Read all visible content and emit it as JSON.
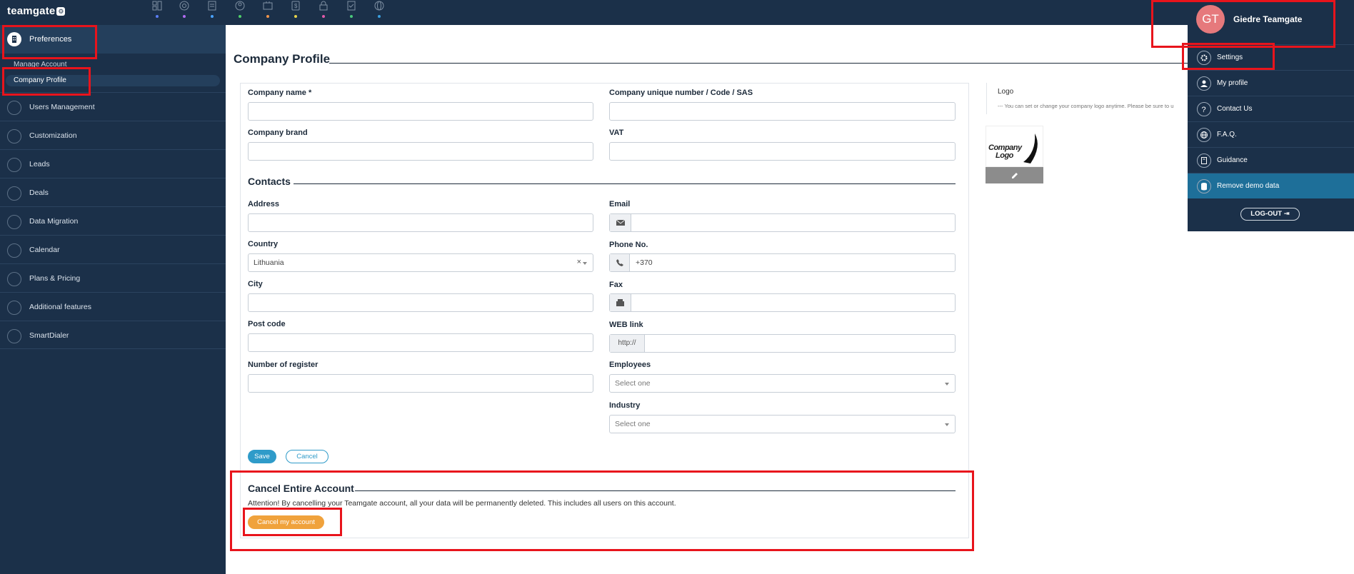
{
  "app": {
    "logo_text": "teamgate",
    "logo_badge": "⚙"
  },
  "topnav": {
    "icons": [
      {
        "name": "dashboard-icon",
        "dot": "#5b7ef5"
      },
      {
        "name": "target-icon",
        "dot": "#b06bf0"
      },
      {
        "name": "reports-icon",
        "dot": "#4aa3ff"
      },
      {
        "name": "leads-icon",
        "dot": "#4fd06a"
      },
      {
        "name": "deals-icon",
        "dot": "#f0934a"
      },
      {
        "name": "pipeline-icon",
        "dot": "#e8d34a"
      },
      {
        "name": "lock-icon",
        "dot": "#e05aa8"
      },
      {
        "name": "tasks-icon",
        "dot": "#49c77b"
      },
      {
        "name": "world-icon",
        "dot": "#3aa0e0"
      }
    ]
  },
  "sidebar": {
    "preferences": "Preferences",
    "sub_manage": "Manage Account",
    "sub_company": "Company Profile",
    "items": [
      {
        "label": "Users Management",
        "icon": "users-icon"
      },
      {
        "label": "Customization",
        "icon": "wrench-icon"
      },
      {
        "label": "Leads",
        "icon": "leads-icon"
      },
      {
        "label": "Deals",
        "icon": "deals-icon"
      },
      {
        "label": "Data Migration",
        "icon": "migration-icon"
      },
      {
        "label": "Calendar",
        "icon": "calendar-icon"
      },
      {
        "label": "Plans & Pricing",
        "icon": "pricing-icon"
      },
      {
        "label": "Additional features",
        "icon": "features-icon"
      },
      {
        "label": "SmartDialer",
        "icon": "phone-icon"
      }
    ]
  },
  "page": {
    "title": "Company Profile"
  },
  "form": {
    "company_name": {
      "label": "Company name *",
      "value": ""
    },
    "company_number": {
      "label": "Company unique number / Code / SAS",
      "value": ""
    },
    "company_brand": {
      "label": "Company brand",
      "value": ""
    },
    "vat": {
      "label": "VAT",
      "value": ""
    },
    "contacts_title": "Contacts",
    "address": {
      "label": "Address",
      "value": ""
    },
    "email": {
      "label": "Email",
      "value": ""
    },
    "country": {
      "label": "Country",
      "value": "Lithuania",
      "clear": "×"
    },
    "phone": {
      "label": "Phone No.",
      "value": "+370"
    },
    "city": {
      "label": "City",
      "value": ""
    },
    "fax": {
      "label": "Fax",
      "value": ""
    },
    "post_code": {
      "label": "Post code",
      "value": ""
    },
    "web": {
      "label": "WEB link",
      "prefix": "http://",
      "value": ""
    },
    "register": {
      "label": "Number of register",
      "value": ""
    },
    "employees": {
      "label": "Employees",
      "value": "Select one"
    },
    "industry": {
      "label": "Industry",
      "value": "Select one"
    },
    "save": "Save",
    "cancel": "Cancel"
  },
  "cancel_section": {
    "title": "Cancel Entire Account",
    "warning": "Attention! By cancelling your Teamgate account, all your data will be permanently deleted. This includes all users on this account.",
    "button": "Cancel my account"
  },
  "logo_panel": {
    "title": "Logo",
    "note": "--- You can set or change your company logo anytime. Please be sure to u",
    "placeholder_line1": "Company",
    "placeholder_line2": "Logo"
  },
  "user_menu": {
    "initials": "GT",
    "name": "Giedre Teamgate",
    "avatar_color": "#e6797c",
    "items": [
      {
        "label": "Settings",
        "icon": "gear-icon"
      },
      {
        "label": "My profile",
        "icon": "user-icon"
      },
      {
        "label": "Contact Us",
        "icon": "question-icon"
      },
      {
        "label": "F.A.Q.",
        "icon": "globe-icon"
      },
      {
        "label": "Guidance",
        "icon": "book-icon"
      },
      {
        "label": "Remove demo data",
        "icon": "database-icon"
      }
    ],
    "logout": "LOG-OUT"
  }
}
